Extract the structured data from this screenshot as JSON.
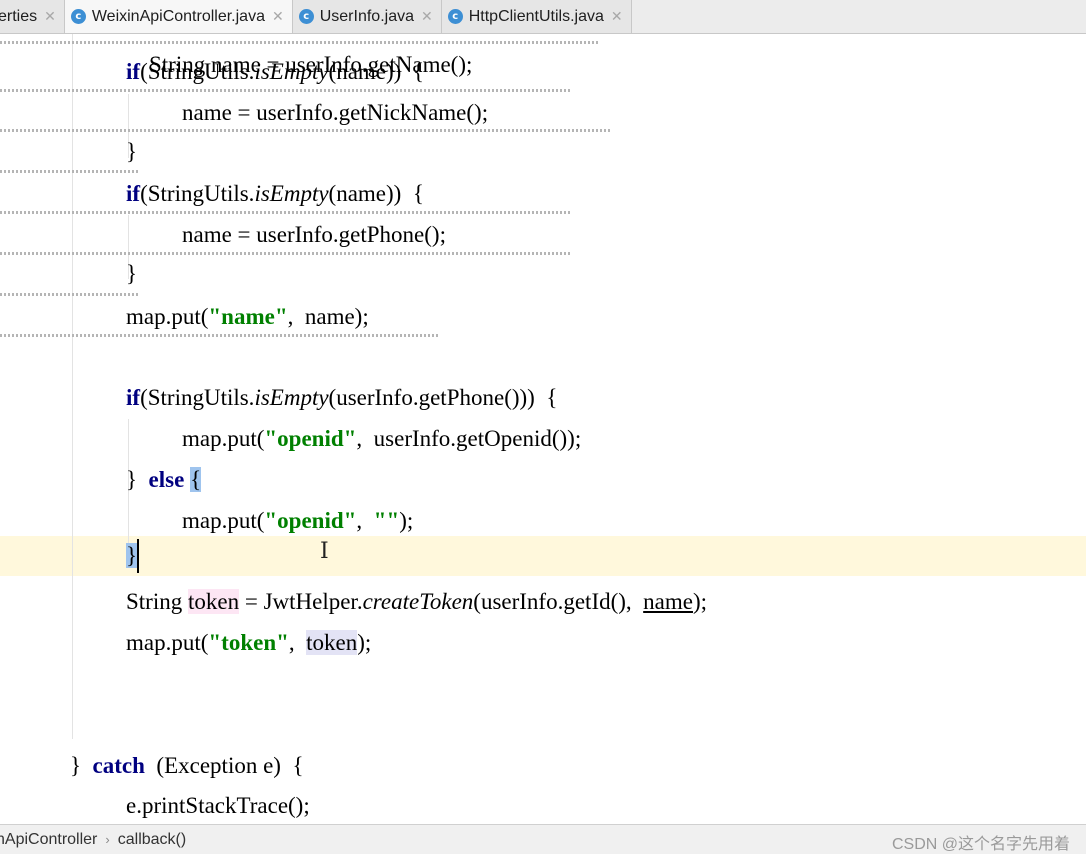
{
  "tabs": [
    {
      "label": "erties",
      "icon": "close"
    },
    {
      "label": "WeixinApiController.java",
      "icon": "java-class-icon"
    },
    {
      "label": "UserInfo.java",
      "icon": "java-class-icon"
    },
    {
      "label": "HttpClientUtils.java",
      "icon": "java-class-icon"
    }
  ],
  "editor": {
    "partial_top": "String name = userInfo.getName();",
    "line_if1_kw": "if",
    "line_if1_a": "(StringUtils.",
    "line_if1_m": "isEmpty",
    "line_if1_b": "(name))  {",
    "line_nick": "name = userInfo.getNickName();",
    "brace_close": "}",
    "line_if2_kw": "if",
    "line_if2_a": "(StringUtils.",
    "line_if2_m": "isEmpty",
    "line_if2_b": "(name))  {",
    "line_phone": "name = userInfo.getPhone();",
    "line_putname_a": "map.put(",
    "line_putname_s": "\"name\"",
    "line_putname_b": ",  name);",
    "line_if3_kw": "if",
    "line_if3_a": "(StringUtils.",
    "line_if3_m": "isEmpty",
    "line_if3_b": "(userInfo.getPhone()))  {",
    "line_putopenid_a": "map.put(",
    "line_putopenid_s": "\"openid\"",
    "line_putopenid_b": ",  userInfo.getOpenid());",
    "line_else_a": "}  ",
    "line_else_kw": "else",
    "line_else_sp": " ",
    "line_else_brace": "{",
    "line_putempty_a": "map.put(",
    "line_putempty_s1": "\"openid\"",
    "line_putempty_c": ",  ",
    "line_putempty_s2": "\"\"",
    "line_putempty_b": ");",
    "line_token_a": "String ",
    "line_token_var": "token",
    "line_token_b": " = JwtHelper.",
    "line_token_m": "createToken",
    "line_token_c": "(userInfo.getId(),  ",
    "line_token_name": "name",
    "line_token_d": ");",
    "line_puttoken_a": "map.put(",
    "line_puttoken_s": "\"token\"",
    "line_puttoken_b": ",  ",
    "line_puttoken_var": "token",
    "line_puttoken_c": ");",
    "line_catch_a": "}  ",
    "line_catch_kw": "catch",
    "line_catch_b": "  (Exception e)  {",
    "line_print": "e.printStackTrace();"
  },
  "breadcrumb": [
    "nApiController",
    "callback()"
  ],
  "watermark": "CSDN @这个名字先用着",
  "colors": {
    "keyword": "#000080",
    "string": "#008000",
    "current_line": "#fff8dc",
    "brace_match": "#9fc4ee"
  }
}
